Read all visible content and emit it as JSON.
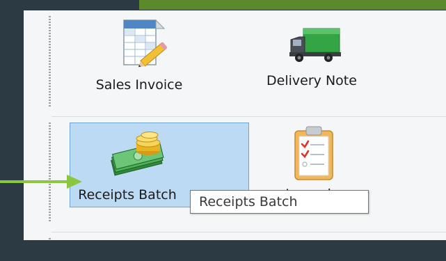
{
  "ribbon": {
    "group1": {
      "tiles": [
        {
          "label": "Sales Invoice",
          "icon": "invoice-spreadsheet-pencil-icon"
        },
        {
          "label": "Delivery Note",
          "icon": "delivery-truck-icon"
        }
      ]
    },
    "group2": {
      "tiles": [
        {
          "label": "Receipts Batch",
          "icon": "cash-coins-icon",
          "selected": true
        },
        {
          "label": "Journals",
          "icon": "clipboard-checklist-icon"
        }
      ]
    }
  },
  "tooltip": {
    "text": "Receipts Batch"
  },
  "colors": {
    "slide_background": "#2b3a43",
    "accent_green": "#5a8a2a",
    "arrow_green": "#8cc63f",
    "selected_fill": "#bcdaf4",
    "selected_border": "#6fa4d6"
  }
}
